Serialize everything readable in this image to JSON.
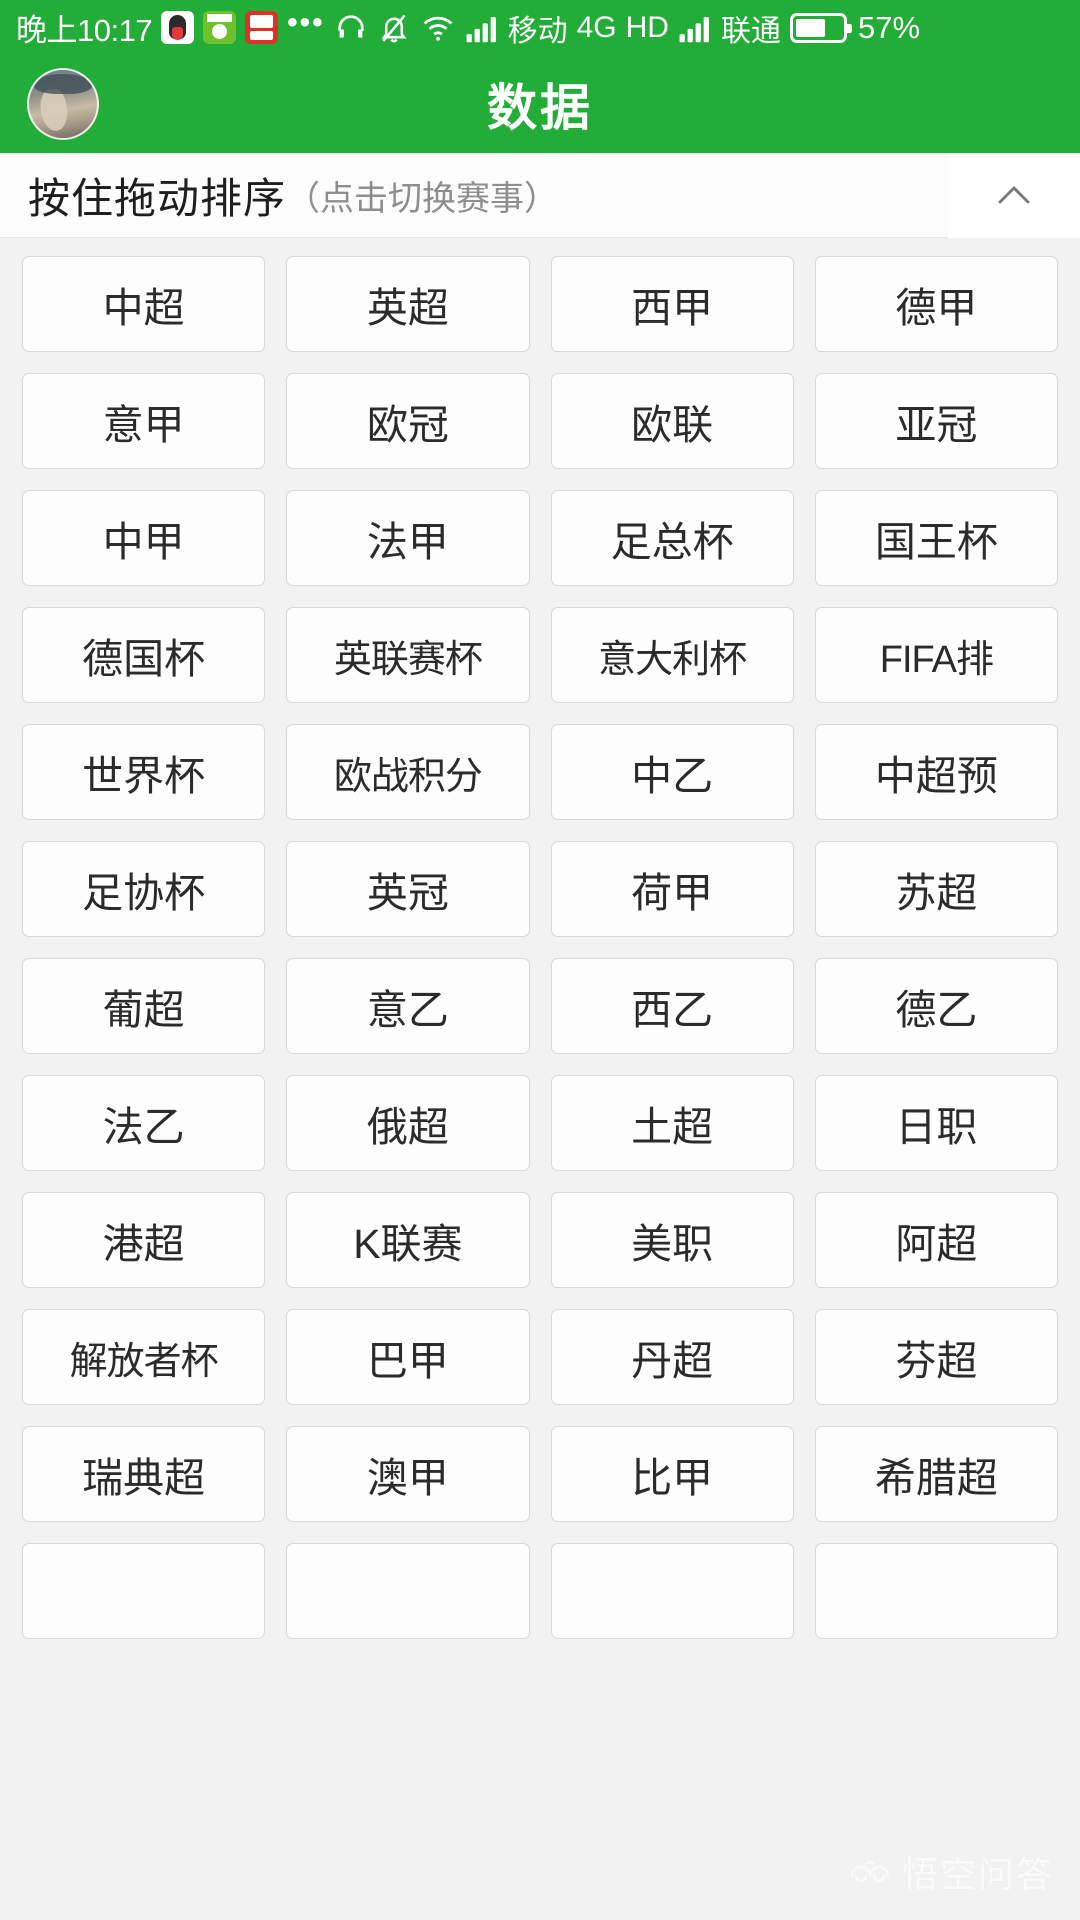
{
  "status_bar": {
    "time": "晚上10:17",
    "app_icons": [
      "qq-icon",
      "green-app-icon",
      "toutiao-icon"
    ],
    "overflow_dots": "•••",
    "icons": [
      "headset-icon",
      "bell-muted-icon",
      "wifi-icon",
      "signal-bars-icon",
      "signal-bars-icon-2"
    ],
    "carrier_primary": "移动",
    "network_type": "4G",
    "hd_label": "HD",
    "carrier_secondary": "联通",
    "battery_percent": "57%",
    "battery_level": 57,
    "background_color": "#22ac38",
    "foreground_color": "#ffffff"
  },
  "header": {
    "title": "数据",
    "avatar_name": "user-avatar",
    "background_color": "#22ac38"
  },
  "subtitle_bar": {
    "main_text": "按住拖动排序",
    "hint_text": "（点击切换赛事）",
    "collapse_icon": "chevron-up-icon"
  },
  "grid": {
    "columns": 4,
    "tiles": [
      "中超",
      "英超",
      "西甲",
      "德甲",
      "意甲",
      "欧冠",
      "欧联",
      "亚冠",
      "中甲",
      "法甲",
      "足总杯",
      "国王杯",
      "德国杯",
      "英联赛杯",
      "意大利杯",
      "FIFA排",
      "世界杯",
      "欧战积分",
      "中乙",
      "中超预",
      "足协杯",
      "英冠",
      "荷甲",
      "苏超",
      "葡超",
      "意乙",
      "西乙",
      "德乙",
      "法乙",
      "俄超",
      "土超",
      "日职",
      "港超",
      "K联赛",
      "美职",
      "阿超",
      "解放者杯",
      "巴甲",
      "丹超",
      "芬超",
      "瑞典超",
      "澳甲",
      "比甲",
      "希腊超",
      "",
      "",
      "",
      ""
    ]
  },
  "watermark": {
    "text": "悟空问答",
    "logo_name": "wukong-logo-icon"
  },
  "colors": {
    "brand_green": "#22ac38",
    "page_background": "#f2f2f2",
    "tile_background": "#fdfdfd",
    "tile_border": "#d9d9d9",
    "text_primary": "#2b2b2b",
    "text_muted": "#8e8e8e"
  }
}
